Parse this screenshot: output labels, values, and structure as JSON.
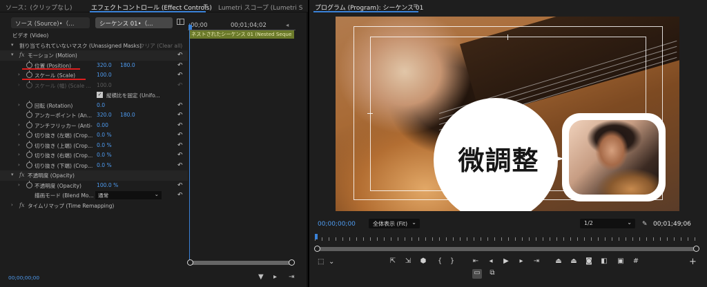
{
  "left_tabs": {
    "source_none": "ソース：(クリップなし)",
    "effect_controls": "エフェクトコントロール (Effect Controls)",
    "lumetri_scope": "Lumetri スコープ (Lumetri S",
    "menu": "≡"
  },
  "clip_tabs": {
    "source": "ソース (Source)•（…",
    "sequence": "シーケンス 01•（…"
  },
  "effects": {
    "video_header": "ビデオ (Video)",
    "mask_row": "割り当てられていないマスク (Unassigned Masks)",
    "clear_all": "クリア (Clear all)",
    "motion": "モーション (Motion)",
    "position_label": "位置 (Position)",
    "position_x": "320.0",
    "position_y": "180.0",
    "scale_label": "スケール (Scale)",
    "scale_value": "100.0",
    "scale_width_label": "スケール (幅) (Scale ...",
    "scale_width_value": "100.0",
    "uniform_label": "縦横比を固定 (Unifo...",
    "rotation_label": "回転 (Rotation)",
    "rotation_value": "0.0",
    "anchor_label": "アンカーポイント (An...",
    "anchor_x": "320.0",
    "anchor_y": "180.0",
    "antiflicker_label": "アンチフリッカー (Anti-",
    "antiflicker_value": "0.00",
    "crop_left_label": "切り抜き (左端) (Crop...",
    "crop_left_value": "0.0 %",
    "crop_top_label": "切り抜き (上端) (Crop...",
    "crop_top_value": "0.0 %",
    "crop_right_label": "切り抜き (右端) (Crop...",
    "crop_right_value": "0.0 %",
    "crop_bottom_label": "切り抜き (下端) (Crop...",
    "crop_bottom_value": "0.0 %",
    "opacity_section": "不透明度 (Opacity)",
    "opacity_label": "不透明度 (Opacity)",
    "opacity_value": "100.0 %",
    "blend_label": "描画モード (Blend Mo...",
    "blend_value": "通常",
    "time_remap": "タイムリマップ (Time Remapping)"
  },
  "timeline": {
    "tc_start": "00;00",
    "tc_mid": "00;01;04;02",
    "clip_name": "ネストされたシーケンス 01 (Nested Seque"
  },
  "left_bottom": {
    "timecode": "00;00;00;00"
  },
  "program": {
    "title": "プログラム (Program): シーケンス 01",
    "menu": "≡",
    "caption": "微調整",
    "timecode": "00;00;00;00",
    "fit_label": "全体表示 (Fit)",
    "resolution": "1/2",
    "duration": "00;01;49;06"
  },
  "icons": {
    "reset": "↶",
    "chev": "⌄"
  },
  "colors": {
    "accent_blue": "#3a82d8",
    "value_blue": "#4e9bf0",
    "annotation_red": "#e01e1e",
    "clip_green": "#6b7a2a"
  }
}
